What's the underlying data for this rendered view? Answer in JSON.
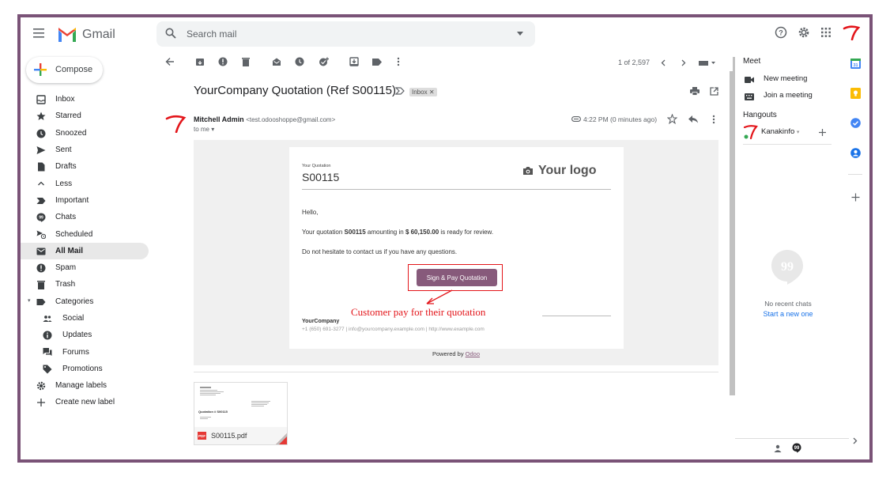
{
  "app": {
    "title": "Gmail"
  },
  "search": {
    "placeholder": "Search mail"
  },
  "compose": {
    "label": "Compose"
  },
  "nav": {
    "items": [
      {
        "label": "Inbox",
        "icon": "inbox-icon"
      },
      {
        "label": "Starred",
        "icon": "star-icon"
      },
      {
        "label": "Snoozed",
        "icon": "clock-icon"
      },
      {
        "label": "Sent",
        "icon": "send-icon"
      },
      {
        "label": "Drafts",
        "icon": "draft-icon"
      },
      {
        "label": "Less",
        "icon": "chevron-up-icon"
      },
      {
        "label": "Important",
        "icon": "important-icon"
      },
      {
        "label": "Chats",
        "icon": "chat-icon"
      },
      {
        "label": "Scheduled",
        "icon": "scheduled-send-icon"
      },
      {
        "label": "All Mail",
        "icon": "all-mail-icon",
        "active": true
      },
      {
        "label": "Spam",
        "icon": "spam-icon"
      },
      {
        "label": "Trash",
        "icon": "trash-icon"
      },
      {
        "label": "Categories",
        "icon": "label-icon"
      },
      {
        "label": "Social",
        "icon": "people-icon",
        "sub": true
      },
      {
        "label": "Updates",
        "icon": "info-icon",
        "sub": true
      },
      {
        "label": "Forums",
        "icon": "forum-icon",
        "sub": true
      },
      {
        "label": "Promotions",
        "icon": "tag-icon",
        "sub": true
      },
      {
        "label": "Manage labels",
        "icon": "gear-icon"
      },
      {
        "label": "Create new label",
        "icon": "plus-icon"
      }
    ]
  },
  "toolbar": {
    "pager": "1 of 2,597"
  },
  "message": {
    "subject": "YourCompany Quotation (Ref S00115)",
    "label": "Inbox",
    "sender_name": "Mitchell Admin",
    "sender_email": "<test.odooshoppe@gmail.com>",
    "to": "to me",
    "time": "4:22 PM (0 minutes ago)"
  },
  "email": {
    "your_quotation": "Your Quotation",
    "quote_number": "S00115",
    "logo_text": "Your logo",
    "greeting": "Hello,",
    "line1_pre": "Your quotation ",
    "line1_ref": "S00115",
    "line1_mid": " amounting in ",
    "line1_amount": "$ 60,150.00",
    "line1_post": " is ready for review.",
    "line2": "Do not hesitate to contact us if you have any questions.",
    "button": "Sign & Pay Quotation",
    "company": "YourCompany",
    "company_info": "+1 (650) 691-3277 | info@yourcompany.example.com | http://www.example.com",
    "powered_by": "Powered by ",
    "powered_link": "Odoo"
  },
  "annotation": "Customer pay for their quotation",
  "attachment": {
    "filename": "S00115.pdf",
    "type": "PDF",
    "thumb_title": "Quotation # S00115"
  },
  "right_panel": {
    "meet_title": "Meet",
    "new_meeting": "New meeting",
    "join_meeting": "Join a meeting",
    "hangouts_title": "Hangouts",
    "contact": "Kanakinfo",
    "no_chats": "No recent chats",
    "start_new": "Start a new one"
  },
  "colors": {
    "accent": "#875a7b",
    "frame": "#7a5377",
    "annotation": "#e3151a",
    "link": "#1a73e8"
  }
}
